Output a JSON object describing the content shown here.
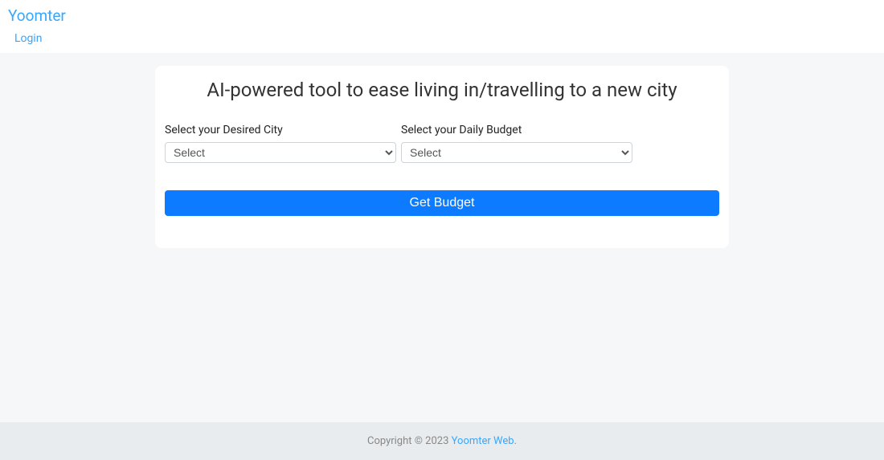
{
  "navbar": {
    "brand": "Yoomter",
    "login": "Login"
  },
  "card": {
    "title": "AI-powered tool to ease living in/travelling to a new city",
    "city_label": "Select your Desired City",
    "budget_label": "Select your Daily Budget",
    "select_placeholder": "Select",
    "submit_label": "Get Budget"
  },
  "footer": {
    "prefix": "Copyright © 2023 ",
    "link": "Yoomter Web",
    "suffix": "."
  }
}
